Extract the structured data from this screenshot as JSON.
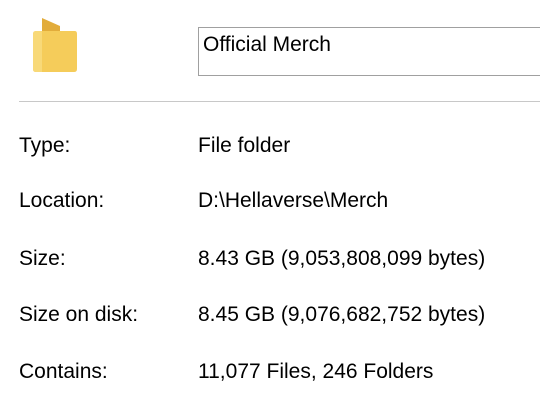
{
  "header": {
    "icon": "folder-icon",
    "folder_color": "#f0c24a",
    "name_value": "Official Merch"
  },
  "properties": [
    {
      "label": "Type:",
      "value": "File folder"
    },
    {
      "label": "Location:",
      "value": "D:\\Hellaverse\\Merch"
    },
    {
      "label": "Size:",
      "value": "8.43 GB (9,053,808,099 bytes)"
    },
    {
      "label": "Size on disk:",
      "value": "8.45 GB (9,076,682,752 bytes)"
    },
    {
      "label": "Contains:",
      "value": "11,077 Files, 246 Folders"
    }
  ]
}
